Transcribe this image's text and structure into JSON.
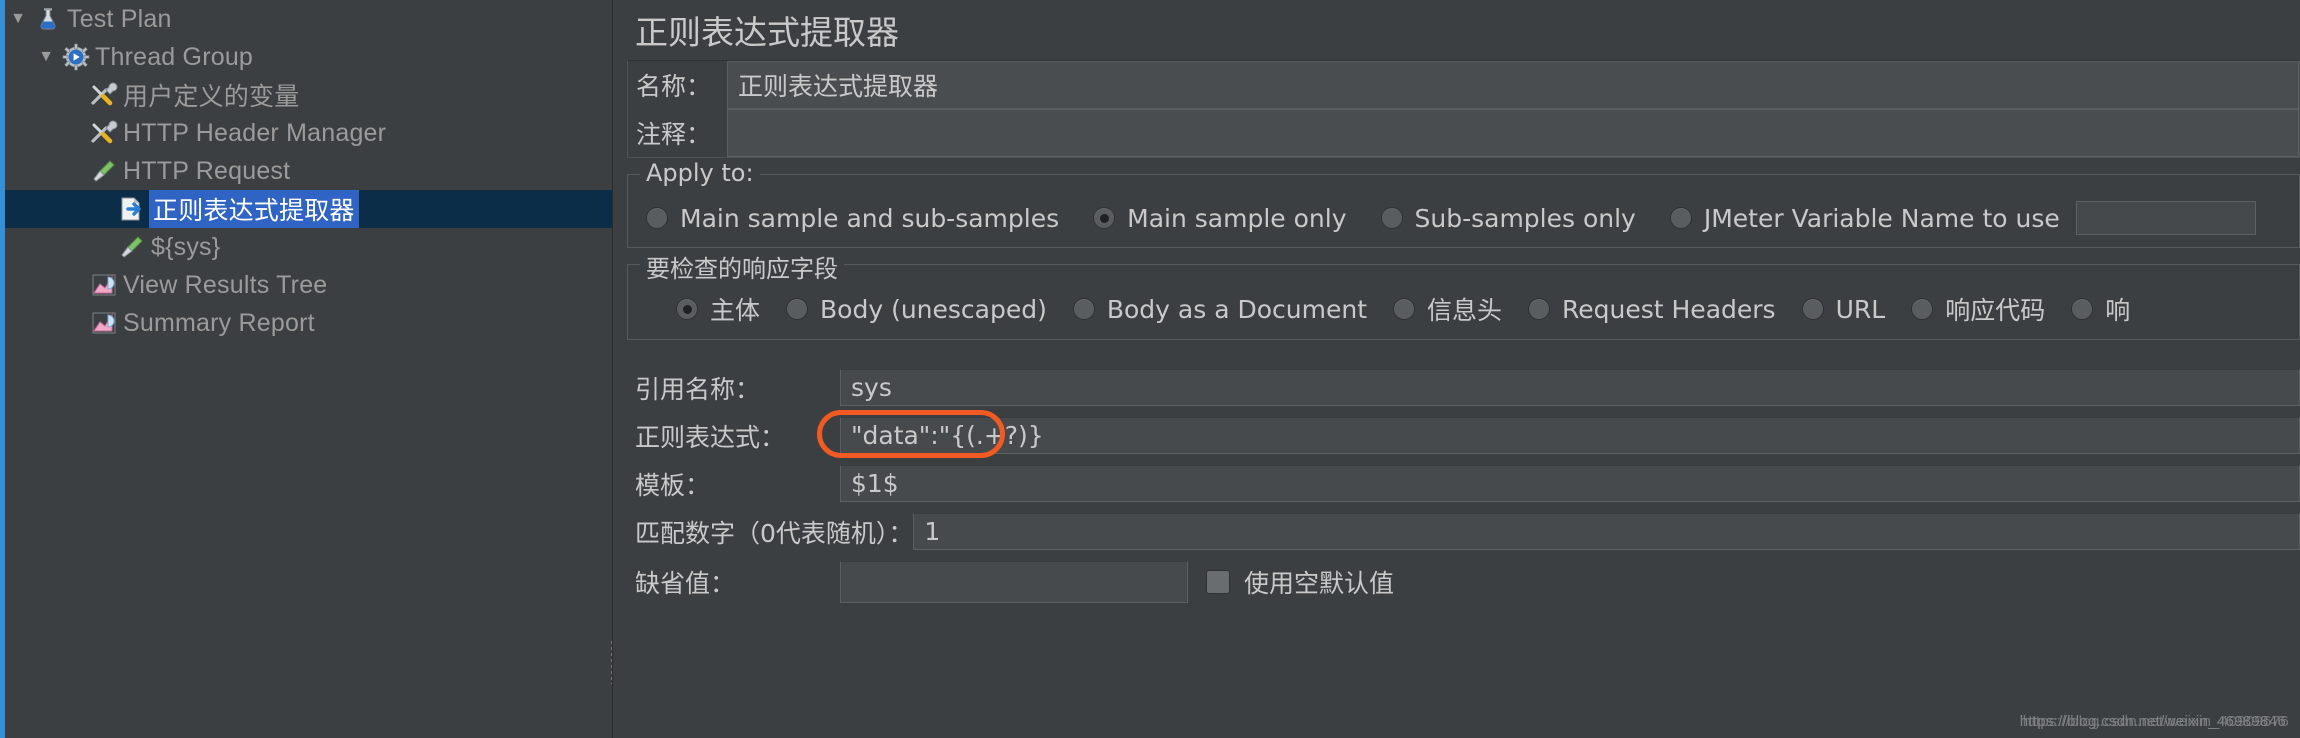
{
  "tree": {
    "items": [
      {
        "label": "Test Plan",
        "icon": "flask-icon",
        "indent": 0,
        "twisty": "▼",
        "selected": false
      },
      {
        "label": "Thread Group",
        "icon": "gear-thread-icon",
        "indent": 1,
        "twisty": "▼",
        "selected": false
      },
      {
        "label": "用户定义的变量",
        "icon": "wrench-screwdriver-icon",
        "indent": 2,
        "twisty": "",
        "selected": false
      },
      {
        "label": "HTTP Header Manager",
        "icon": "wrench-screwdriver-icon",
        "indent": 2,
        "twisty": "",
        "selected": false
      },
      {
        "label": "HTTP Request",
        "icon": "pipette-icon",
        "indent": 2,
        "twisty": "",
        "selected": false
      },
      {
        "label": "正则表达式提取器",
        "icon": "page-arrow-icon",
        "indent": 3,
        "twisty": "",
        "selected": true
      },
      {
        "label": "${sys}",
        "icon": "pipette-icon",
        "indent": 3,
        "twisty": "",
        "selected": false
      },
      {
        "label": "View Results Tree",
        "icon": "chart-icon",
        "indent": 2,
        "twisty": "",
        "selected": false
      },
      {
        "label": "Summary Report",
        "icon": "chart-icon",
        "indent": 2,
        "twisty": "",
        "selected": false
      }
    ]
  },
  "editor": {
    "title": "正则表达式提取器",
    "name_label": "名称：",
    "name_value": "正则表达式提取器",
    "comment_label": "注释：",
    "comment_value": "",
    "apply_to": {
      "title": "Apply to:",
      "options": [
        {
          "label": "Main sample and sub-samples",
          "checked": false
        },
        {
          "label": "Main sample only",
          "checked": true
        },
        {
          "label": "Sub-samples only",
          "checked": false
        },
        {
          "label": "JMeter Variable Name to use",
          "checked": false,
          "has_input": true,
          "input_value": ""
        }
      ]
    },
    "field_to_check": {
      "title": "要检查的响应字段",
      "options": [
        {
          "label": "主体",
          "checked": true
        },
        {
          "label": "Body (unescaped)",
          "checked": false
        },
        {
          "label": "Body as a Document",
          "checked": false
        },
        {
          "label": "信息头",
          "checked": false
        },
        {
          "label": "Request Headers",
          "checked": false
        },
        {
          "label": "URL",
          "checked": false
        },
        {
          "label": "响应代码",
          "checked": false
        },
        {
          "label": "响",
          "checked": false
        }
      ]
    },
    "fields": [
      {
        "label": "引用名称：",
        "value": "sys",
        "highlighted": false
      },
      {
        "label": "正则表达式：",
        "value": "\"data\":\"{(.+?)}",
        "highlighted": true
      },
      {
        "label": "模板：",
        "value": "$1$",
        "highlighted": false
      },
      {
        "label": "匹配数字（0代表随机）：",
        "value": "1",
        "highlighted": false
      }
    ],
    "default_value": {
      "label": "缺省值：",
      "value": "",
      "checkbox_label": "使用空默认值",
      "checked": false
    }
  },
  "colors": {
    "background": "#3c3f41",
    "selection": "#2f63c4",
    "selection_row": "#0c2d48",
    "accent_border": "#3390d8",
    "highlight": "#f15a22",
    "text": "#c9c9c9"
  },
  "watermark": {
    "line1": "https://blog.csdn.net/weixin_46989846",
    "line2": "https://blog.csdn.net/weixin_40909676"
  }
}
